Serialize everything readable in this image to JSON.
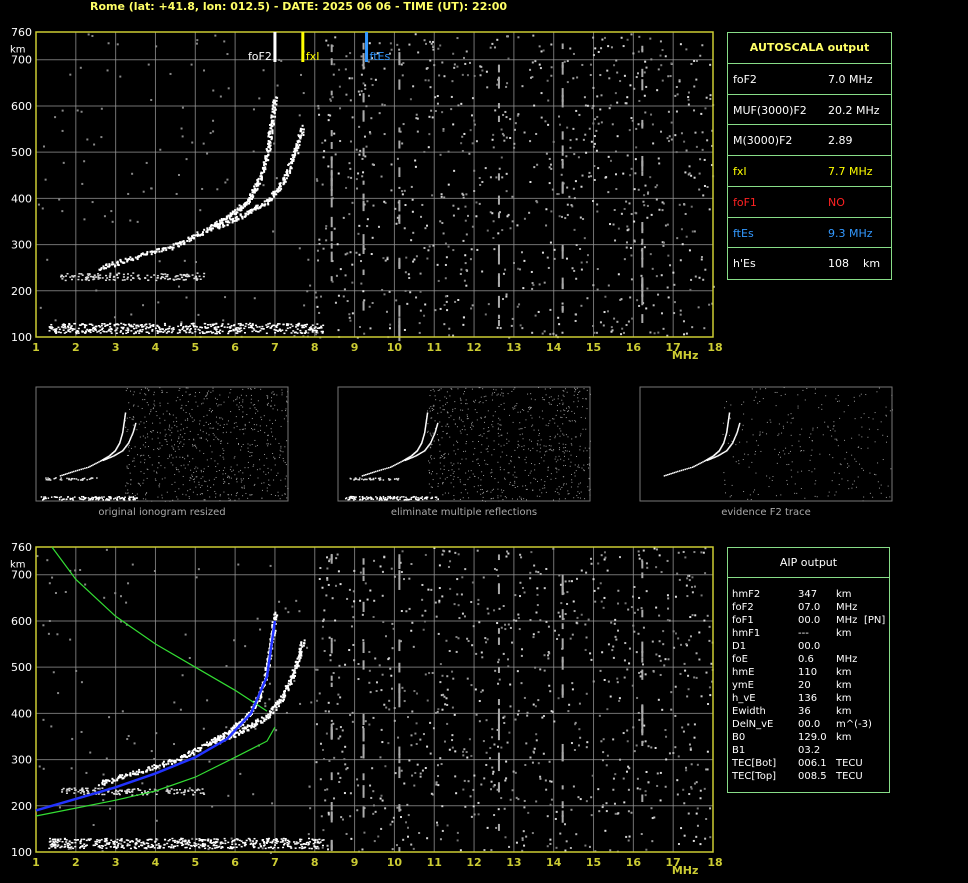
{
  "header": {
    "text": "Rome (lat: +41.8, lon: 012.5) - DATE: 2025 06 06 - TIME (UT): 22:00"
  },
  "colors": {
    "axis": "#cccc33",
    "grid": "#999999",
    "table_border": "#88dd88",
    "foF2": "#ffffff",
    "fxI": "#ffff00",
    "ftEs": "#3399ff",
    "foF1": "#ff2222",
    "aip_blue": "#2233ff",
    "aip_green": "#33dd33"
  },
  "chart_data": [
    {
      "type": "scatter",
      "name": "ionogram-top",
      "xlabel": "MHz",
      "ylabel": "km",
      "xlim": [
        1,
        18
      ],
      "ylim": [
        100,
        760
      ],
      "xticks": [
        "1",
        "2",
        "3",
        "4",
        "5",
        "6",
        "7",
        "8",
        "9",
        "10",
        "11",
        "12",
        "13",
        "14",
        "15",
        "16",
        "17",
        "18"
      ],
      "yticks": [
        "100",
        "200",
        "300",
        "400",
        "500",
        "600",
        "700",
        "760"
      ],
      "grid": true,
      "markers": [
        {
          "label": "foF2",
          "x": 7.0,
          "color": "#ffffff"
        },
        {
          "label": "fxI",
          "x": 7.7,
          "color": "#ffff00"
        },
        {
          "label": "ftEs",
          "x": 9.3,
          "color": "#3399ff"
        }
      ],
      "traces": {
        "es_layer": {
          "x": [
            1.3,
            8.2
          ],
          "y": 120
        },
        "es_second": {
          "x": [
            1.6,
            5.2
          ],
          "y": 232
        },
        "f_o_trace": [
          [
            2.6,
            250
          ],
          [
            3.5,
            275
          ],
          [
            4.5,
            300
          ],
          [
            5.3,
            335
          ],
          [
            5.9,
            365
          ],
          [
            6.3,
            395
          ],
          [
            6.6,
            440
          ],
          [
            6.8,
            500
          ],
          [
            6.9,
            560
          ],
          [
            7.0,
            620
          ]
        ],
        "f_x_trace": [
          [
            5.5,
            340
          ],
          [
            6.2,
            365
          ],
          [
            6.8,
            395
          ],
          [
            7.2,
            440
          ],
          [
            7.5,
            500
          ],
          [
            7.7,
            560
          ]
        ]
      }
    },
    {
      "type": "scatter",
      "name": "ionogram-bottom",
      "xlabel": "MHz",
      "ylabel": "km",
      "xlim": [
        1,
        18
      ],
      "ylim": [
        100,
        760
      ],
      "xticks": [
        "1",
        "2",
        "3",
        "4",
        "5",
        "6",
        "7",
        "8",
        "9",
        "10",
        "11",
        "12",
        "13",
        "14",
        "15",
        "16",
        "17",
        "18"
      ],
      "yticks": [
        "100",
        "200",
        "300",
        "400",
        "500",
        "600",
        "700",
        "760"
      ],
      "grid": true,
      "blue_profile": [
        [
          1.0,
          190
        ],
        [
          2.0,
          215
        ],
        [
          3.0,
          240
        ],
        [
          4.0,
          270
        ],
        [
          5.0,
          305
        ],
        [
          5.8,
          345
        ],
        [
          6.4,
          400
        ],
        [
          6.8,
          480
        ],
        [
          7.0,
          600
        ]
      ],
      "green_curve_a": [
        [
          1.4,
          760
        ],
        [
          2.0,
          690
        ],
        [
          3.0,
          610
        ],
        [
          4.0,
          550
        ],
        [
          5.0,
          500
        ],
        [
          6.0,
          450
        ],
        [
          6.8,
          405
        ]
      ],
      "green_curve_b": [
        [
          1.0,
          178
        ],
        [
          2.0,
          195
        ],
        [
          3.0,
          212
        ],
        [
          4.0,
          232
        ],
        [
          5.0,
          262
        ],
        [
          6.0,
          305
        ],
        [
          6.8,
          340
        ],
        [
          7.0,
          370
        ]
      ]
    }
  ],
  "autoscala": {
    "title": "AUTOSCALA output",
    "rows": [
      {
        "label": "foF2",
        "value": "7.0 MHz",
        "color": "#ffffff"
      },
      {
        "label": "MUF(3000)F2",
        "value": "20.2 MHz",
        "color": "#ffffff"
      },
      {
        "label": "M(3000)F2",
        "value": "2.89",
        "color": "#ffffff"
      },
      {
        "label": "fxI",
        "value": "7.7 MHz",
        "color": "#ffff00"
      },
      {
        "label": "foF1",
        "value": "NO",
        "color": "#ff2222"
      },
      {
        "label": "ftEs",
        "value": "9.3 MHz",
        "color": "#3399ff"
      },
      {
        "label": "h'Es",
        "value": "108    km",
        "color": "#ffffff"
      }
    ]
  },
  "thumbnails": [
    {
      "caption": "original ionogram resized"
    },
    {
      "caption": "eliminate multiple reflections"
    },
    {
      "caption": "evidence F2 trace"
    }
  ],
  "aip": {
    "title": "AIP output",
    "rows": [
      {
        "k": "hmF2",
        "v": "347",
        "u": "km",
        "x": ""
      },
      {
        "k": "foF2",
        "v": "07.0",
        "u": "MHz",
        "x": ""
      },
      {
        "k": "foF1",
        "v": "00.0",
        "u": "MHz",
        "x": "[PN]"
      },
      {
        "k": "hmF1",
        "v": "---",
        "u": "km",
        "x": ""
      },
      {
        "k": "D1",
        "v": "00.0",
        "u": "",
        "x": ""
      },
      {
        "k": "foE",
        "v": "0.6",
        "u": "MHz",
        "x": ""
      },
      {
        "k": "hmE",
        "v": "110",
        "u": "km",
        "x": ""
      },
      {
        "k": "ymE",
        "v": "20",
        "u": "km",
        "x": ""
      },
      {
        "k": "h_vE",
        "v": "136",
        "u": "km",
        "x": ""
      },
      {
        "k": "Ewidth",
        "v": "36",
        "u": "km",
        "x": ""
      },
      {
        "k": "DelN_vE",
        "v": "00.0",
        "u": "m^(-3)",
        "x": ""
      },
      {
        "k": "B0",
        "v": "129.0",
        "u": "km",
        "x": ""
      },
      {
        "k": "B1",
        "v": "03.2",
        "u": "",
        "x": ""
      },
      {
        "k": "TEC[Bot]",
        "v": "006.1",
        "u": "TECU",
        "x": ""
      },
      {
        "k": "TEC[Top]",
        "v": "008.5",
        "u": "TECU",
        "x": ""
      }
    ]
  }
}
